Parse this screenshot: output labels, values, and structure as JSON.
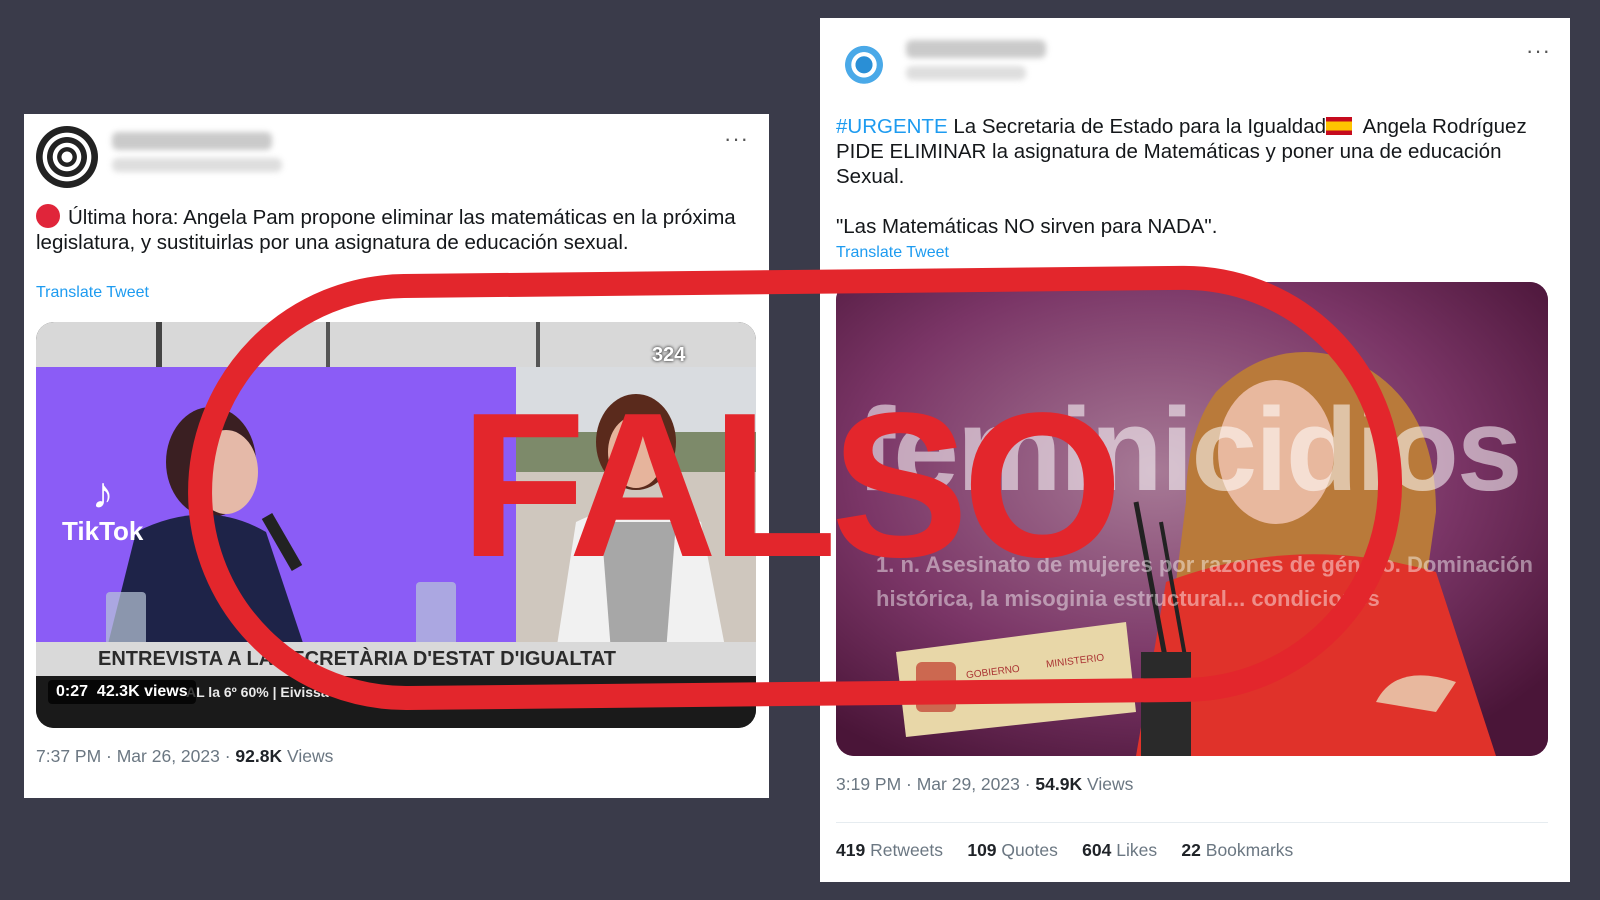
{
  "left_tweet": {
    "text": "Última hora: Angela Pam propone eliminar las matemáticas en la próxima legislatura, y sustituirlas por una asignatura de educación sexual.",
    "translate": "Translate Tweet",
    "more": "···",
    "video": {
      "banner": "ENTREVISTA A LA SECRETÀRIA D'ESTAT D'IGUALTAT",
      "ticker": "AL la 6º 60%  |  Eivissa 10° 89%  |  Palma 15° 92%",
      "duration": "0:27",
      "views": "42.3K views",
      "tiktok": "TikTok",
      "channel": "324"
    },
    "time": "7:37 PM · Mar 26, 2023 · ",
    "views_count": "92.8K",
    "views_label": " Views"
  },
  "right_tweet": {
    "hashtag": "#URGENTE",
    "text1": " La Secretaria de Estado para la Igualdad",
    "text2": " Angela Rodríguez PIDE ELIMINAR la asignatura de Matemáticas y poner una de educación Sexual.",
    "quote": "\"Las Matemáticas NO sirven para NADA\".",
    "translate": "Translate Tweet",
    "more": "···",
    "image": {
      "backdrop_word": "feminicidios",
      "backdrop_line1": "1. n. Asesinato de mujeres por razones de género. Dominación",
      "backdrop_line2": "histórica, la misoginia estructural... condiciones",
      "podium_text1": "GOBIERNO",
      "podium_text2": "MINISTERIO"
    },
    "time": "3:19 PM · Mar 29, 2023 · ",
    "views_count": "54.9K",
    "views_label": " Views",
    "stats": [
      {
        "count": "419",
        "label": "Retweets"
      },
      {
        "count": "109",
        "label": "Quotes"
      },
      {
        "count": "604",
        "label": "Likes"
      },
      {
        "count": "22",
        "label": "Bookmarks"
      }
    ]
  },
  "stamp": {
    "label": "FALSO",
    "color": "#e3262c"
  },
  "colors": {
    "background": "#3a3b4a",
    "link": "#1d9bf0",
    "video_purple": "#8b5cf6",
    "image_purple": "#6b2458"
  }
}
